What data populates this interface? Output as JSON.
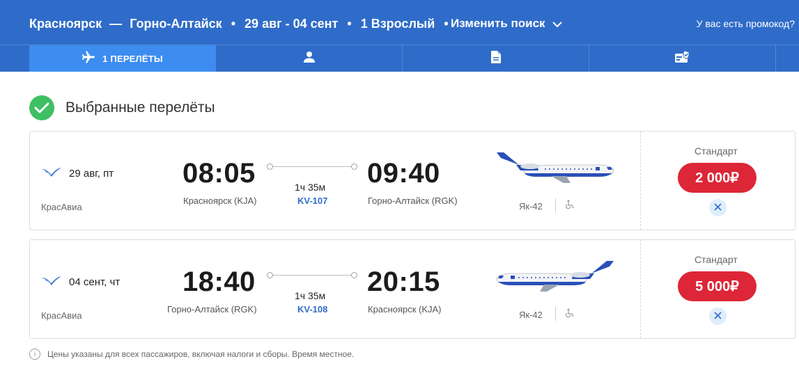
{
  "header": {
    "origin": "Красноярск",
    "dash": "—",
    "destination": "Горно-Алтайск",
    "dates": "29 авг - 04 сент",
    "passengers": "1 Взрослый",
    "separator": "•",
    "change_search": "Изменить поиск",
    "promo": "У вас есть промокод?"
  },
  "steps": {
    "flights_label": "1 ПЕРЕЛЁТЫ",
    "icons": [
      "plane-icon",
      "passenger-icon",
      "document-icon",
      "checkout-icon"
    ]
  },
  "section": {
    "title": "Выбранные перелёты"
  },
  "flights": [
    {
      "date": "29 авг, пт",
      "airline": "КрасАвиа",
      "dep_time": "08:05",
      "dep_city": "Красноярск (KJA)",
      "arr_time": "09:40",
      "arr_city": "Горно-Алтайск (RGK)",
      "duration": "1ч 35м",
      "flight_no": "KV-107",
      "aircraft": "Як-42",
      "fare": "Стандарт",
      "price": "2 000₽"
    },
    {
      "date": "04 сент, чт",
      "airline": "КрасАвиа",
      "dep_time": "18:40",
      "dep_city": "Горно-Алтайск (RGK)",
      "arr_time": "20:15",
      "arr_city": "Красноярск (KJA)",
      "duration": "1ч 35м",
      "flight_no": "KV-108",
      "aircraft": "Як-42",
      "fare": "Стандарт",
      "price": "5 000₽"
    }
  ],
  "footnote": "Цены указаны для всех пассажиров, включая налоги и сборы. Время местное.",
  "colors": {
    "header_bg": "#2f6cc9",
    "active_step": "#3d8cf0",
    "price_bg": "#dd2637",
    "check_bg": "#3fbf63",
    "link": "#2f6cc9"
  }
}
